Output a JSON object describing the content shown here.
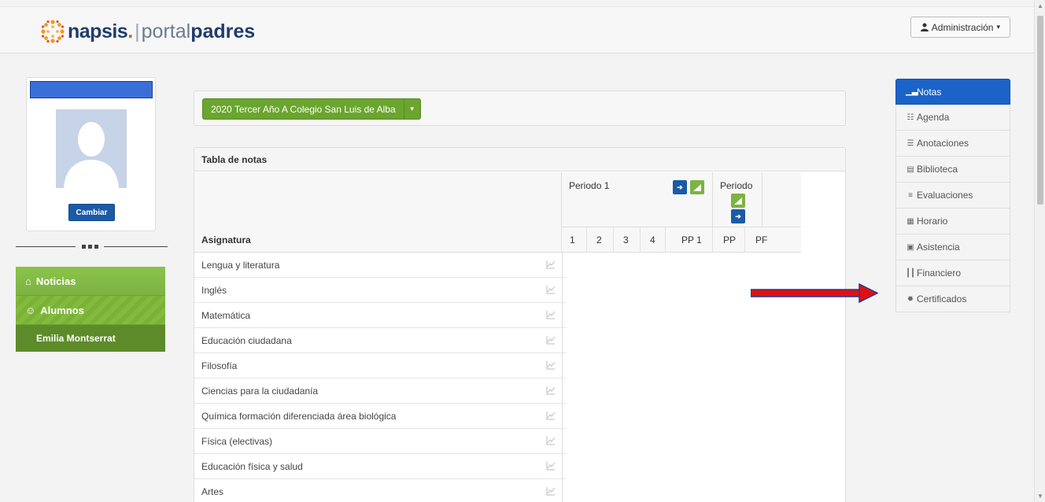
{
  "header": {
    "brand": "napsis",
    "brand_dot": ".",
    "separator": "|",
    "portal": "portal",
    "padres": "padres",
    "admin_label": "Administración",
    "admin_caret": "▾",
    "admin_icon": "user-icon"
  },
  "profile": {
    "change_label": "Cambiar"
  },
  "leftnav": {
    "items": [
      {
        "icon": "home-icon",
        "glyph": "⌂",
        "label": "Noticias"
      },
      {
        "icon": "user-icon",
        "glyph": "☺",
        "label": "Alumnos"
      }
    ],
    "sub_item": "Emilia Montserrat"
  },
  "year_selector": {
    "label": "2020 Tercer Año A Colegio San Luis de Alba",
    "caret": "▾"
  },
  "notes": {
    "title": "Tabla de notas",
    "period1": "Periodo 1",
    "period2": "Periodo",
    "columns": {
      "subject": "Asignatura",
      "c1": "1",
      "c2": "2",
      "c3": "3",
      "c4": "4",
      "pp1": "PP 1",
      "pp": "PP",
      "pf": "PF"
    },
    "subjects": [
      "Lengua y literatura",
      "Inglés",
      "Matemática",
      "Educación ciudadana",
      "Filosofía",
      "Ciencias para la ciudadanía",
      "Química formación diferenciada área biológica",
      "Física (electivas)",
      "Educación física y salud",
      "Artes"
    ]
  },
  "rightnav": {
    "items": [
      {
        "icon": "bar-chart-icon",
        "glyph": "▁▃",
        "label": "Notas",
        "active": true
      },
      {
        "icon": "grid-icon",
        "glyph": "☷",
        "label": "Agenda"
      },
      {
        "icon": "list-icon",
        "glyph": "☰",
        "label": "Anotaciones"
      },
      {
        "icon": "book-icon",
        "glyph": "▤",
        "label": "Biblioteca"
      },
      {
        "icon": "list-icon",
        "glyph": "≡",
        "label": "Evaluaciones"
      },
      {
        "icon": "table-icon",
        "glyph": "▦",
        "label": "Horario"
      },
      {
        "icon": "calendar-icon",
        "glyph": "▣",
        "label": "Asistencia"
      },
      {
        "icon": "columns-icon",
        "glyph": "┃┃",
        "label": "Financiero"
      },
      {
        "icon": "certificate-icon",
        "glyph": "✹",
        "label": "Certificados"
      }
    ]
  },
  "colors": {
    "brand_navy": "#1f3d6d",
    "green": "#7cb342",
    "blue": "#1b63c9",
    "arrow_red": "#e01010"
  }
}
